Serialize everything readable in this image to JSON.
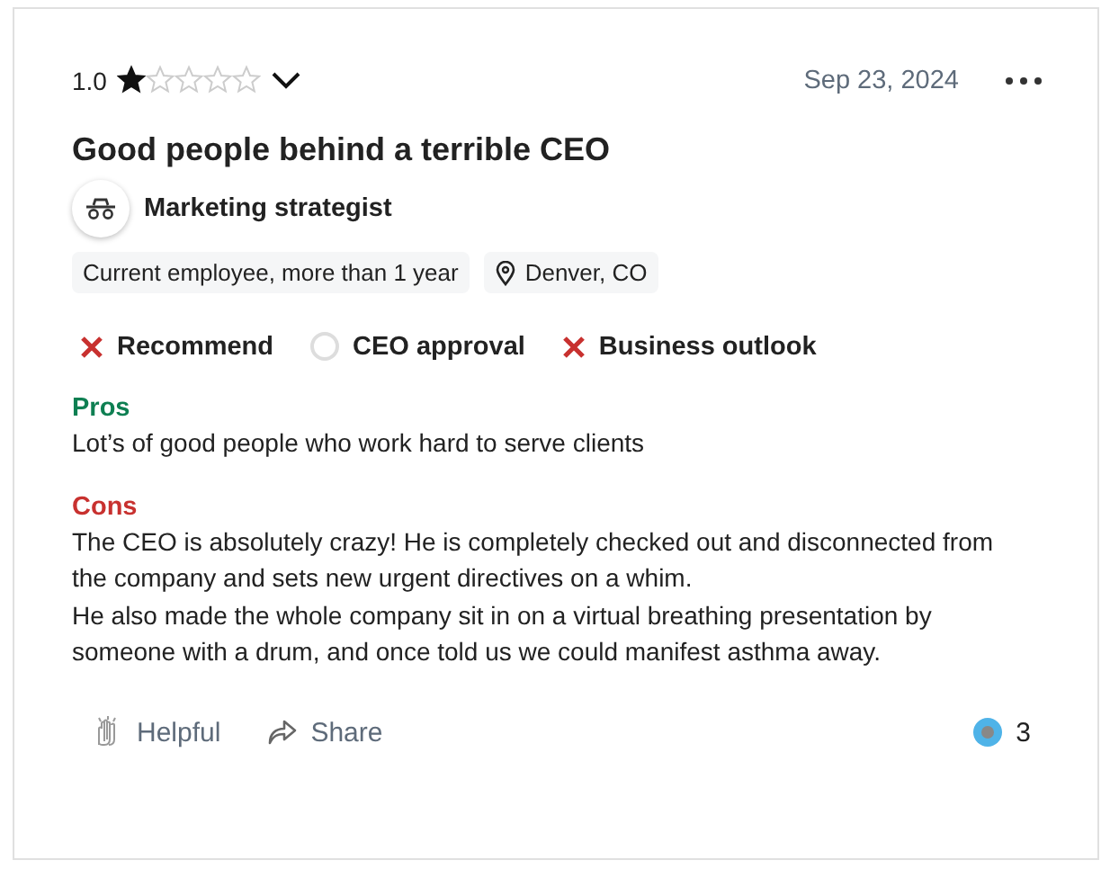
{
  "review": {
    "rating": "1.0",
    "stars": 1,
    "date": "Sep 23, 2024",
    "title": "Good people behind a terrible CEO",
    "job_title": "Marketing strategist",
    "tags": [
      {
        "kind": "employment",
        "label": "Current employee, more than 1 year"
      },
      {
        "kind": "location",
        "label": "Denver, CO"
      }
    ],
    "ratings": [
      {
        "kind": "negative",
        "label": "Recommend"
      },
      {
        "kind": "neutral",
        "label": "CEO approval"
      },
      {
        "kind": "negative",
        "label": "Business outlook"
      }
    ],
    "pros": {
      "heading": "Pros",
      "text": "Lot’s of good people who work hard to serve clients"
    },
    "cons": {
      "heading": "Cons",
      "paragraphs": [
        "The CEO is absolutely crazy! He is completely checked out and disconnected from the company and sets new urgent directives on a whim.",
        "He also made the whole company sit in on a virtual breathing presentation by someone with a drum, and once told us we could manifest asthma away."
      ]
    },
    "actions": [
      {
        "kind": "helpful",
        "label": "Helpful"
      },
      {
        "kind": "share",
        "label": "Share"
      }
    ],
    "helpful_count": "3"
  }
}
